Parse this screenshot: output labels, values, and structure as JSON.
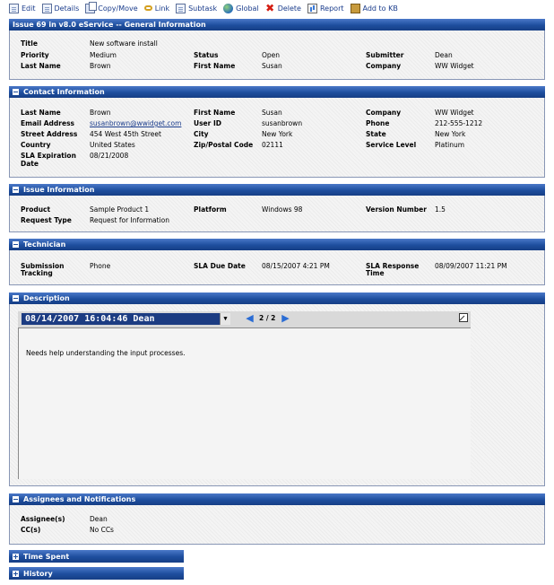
{
  "toolbar": [
    {
      "label": "Edit",
      "icon": "edit-icon"
    },
    {
      "label": "Details",
      "icon": "details-icon"
    },
    {
      "label": "Copy/Move",
      "icon": "copy-icon"
    },
    {
      "label": "Link",
      "icon": "link-icon"
    },
    {
      "label": "Subtask",
      "icon": "subtask-icon"
    },
    {
      "label": "Global",
      "icon": "globe-icon"
    },
    {
      "label": "Delete",
      "icon": "delete-icon"
    },
    {
      "label": "Report",
      "icon": "report-icon"
    },
    {
      "label": "Add to KB",
      "icon": "kb-icon"
    }
  ],
  "general": {
    "header": "Issue 69 in v8.0 eService -- General Information",
    "title_label": "Title",
    "title_value": "New software install",
    "priority_label": "Priority",
    "priority_value": "Medium",
    "status_label": "Status",
    "status_value": "Open",
    "submitter_label": "Submitter",
    "submitter_value": "Dean",
    "lastname_label": "Last Name",
    "lastname_value": "Brown",
    "firstname_label": "First Name",
    "firstname_value": "Susan",
    "company_label": "Company",
    "company_value": "WW Widget"
  },
  "contact": {
    "header": "Contact Information",
    "lastname_label": "Last Name",
    "lastname_value": "Brown",
    "firstname_label": "First Name",
    "firstname_value": "Susan",
    "company_label": "Company",
    "company_value": "WW Widget",
    "email_label": "Email Address",
    "email_value": "susanbrown@wwidget.com",
    "userid_label": "User ID",
    "userid_value": "susanbrown",
    "phone_label": "Phone",
    "phone_value": "212-555-1212",
    "street_label": "Street Address",
    "street_value": "454 West 45th Street",
    "city_label": "City",
    "city_value": "New York",
    "state_label": "State",
    "state_value": "New York",
    "country_label": "Country",
    "country_value": "United States",
    "zip_label": "Zip/Postal Code",
    "zip_value": "02111",
    "service_label": "Service Level",
    "service_value": "Platinum",
    "sla_label_1": "SLA Expiration",
    "sla_label_2": "Date",
    "sla_value": "08/21/2008"
  },
  "issue": {
    "header": "Issue Information",
    "product_label": "Product",
    "product_value": "Sample Product 1",
    "platform_label": "Platform",
    "platform_value": "Windows 98",
    "version_label": "Version Number",
    "version_value": "1.5",
    "request_label": "Request Type",
    "request_value": "Request for Information"
  },
  "technician": {
    "header": "Technician",
    "submission_label_1": "Submission",
    "submission_label_2": "Tracking",
    "submission_value": "Phone",
    "duedate_label": "SLA Due Date",
    "duedate_value": "08/15/2007 4:21 PM",
    "response_label_1": "SLA Response",
    "response_label_2": "Time",
    "response_value": "08/09/2007 11:21 PM"
  },
  "description": {
    "header": "Description",
    "selected_entry": "08/14/2007 16:04:46 Dean",
    "pager": "2 / 2",
    "text": "Needs help understanding the input processes."
  },
  "assignees": {
    "header": "Assignees and Notifications",
    "assignee_label": "Assignee(s)",
    "assignee_value": "Dean",
    "cc_label": "CC(s)",
    "cc_value": "No CCs"
  },
  "collapsed": {
    "time_spent": "Time Spent",
    "history": "History"
  }
}
